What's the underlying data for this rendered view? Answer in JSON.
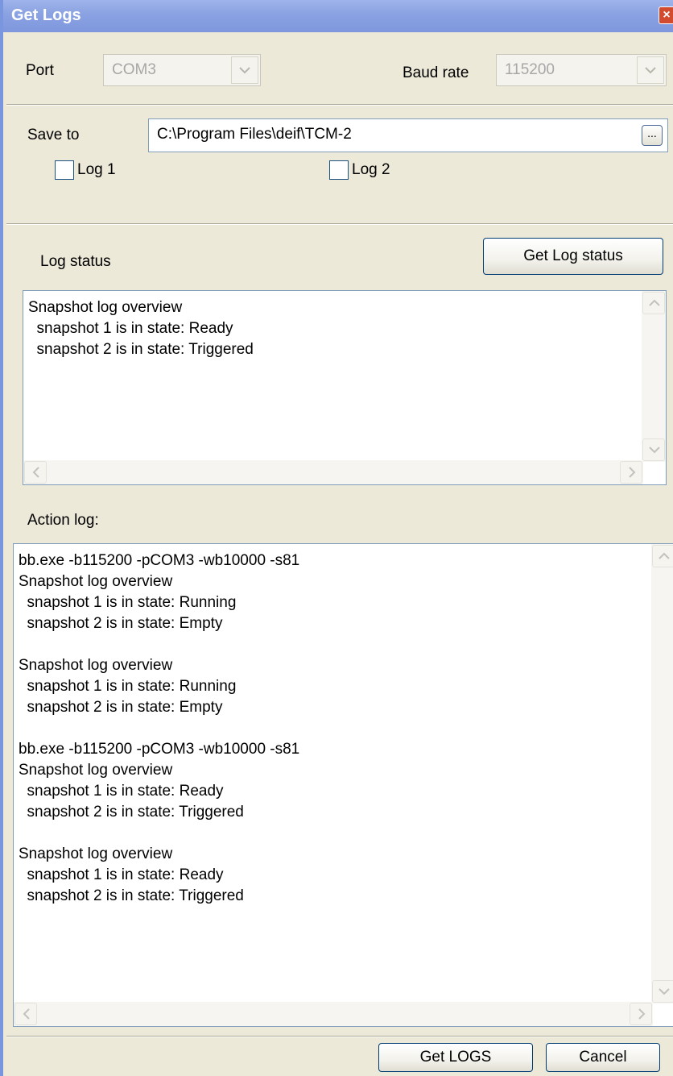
{
  "window": {
    "title": "Get Logs",
    "close_glyph": "×"
  },
  "port": {
    "label": "Port",
    "value": "COM3"
  },
  "baud": {
    "label": "Baud rate",
    "value": "115200"
  },
  "save": {
    "label": "Save to",
    "path": "C:\\Program Files\\deif\\TCM-2",
    "browse_label": "..."
  },
  "logs": {
    "log1_label": "Log 1",
    "log2_label": "Log 2",
    "log1_checked": false,
    "log2_checked": false
  },
  "log_status": {
    "label": "Log status",
    "button_label": "Get Log status",
    "lines": [
      "Snapshot log overview",
      "  snapshot 1 is in state: Ready",
      "  snapshot 2 is in state: Triggered"
    ]
  },
  "action_log": {
    "label": "Action log:",
    "lines": [
      "bb.exe -b115200 -pCOM3 -wb10000 -s81",
      "Snapshot log overview",
      "  snapshot 1 is in state: Running",
      "  snapshot 2 is in state: Empty",
      "",
      "Snapshot log overview",
      "  snapshot 1 is in state: Running",
      "  snapshot 2 is in state: Empty",
      "",
      "bb.exe -b115200 -pCOM3 -wb10000 -s81",
      "Snapshot log overview",
      "  snapshot 1 is in state: Ready",
      "  snapshot 2 is in state: Triggered",
      "",
      "Snapshot log overview",
      "  snapshot 1 is in state: Ready",
      "  snapshot 2 is in state: Triggered"
    ]
  },
  "footer": {
    "get_logs_label": "Get LOGS",
    "cancel_label": "Cancel"
  },
  "icons": {
    "close": "close-icon",
    "dropdown": "chevron-down-icon",
    "scroll_up": "scroll-up-arrow-icon",
    "scroll_down": "scroll-down-arrow-icon",
    "scroll_left": "scroll-left-arrow-icon",
    "scroll_right": "scroll-right-arrow-icon"
  },
  "colors": {
    "titlebar": "#8AA2E2",
    "dialog_bg": "#ECE9D8",
    "close_button": "#D24B2E",
    "button_border": "#003C74"
  }
}
